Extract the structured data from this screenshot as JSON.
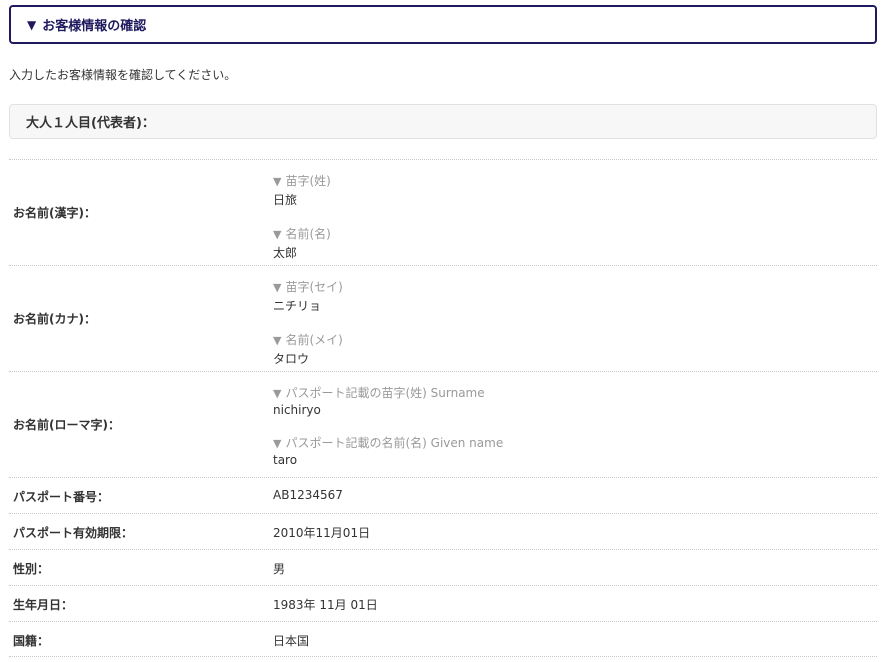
{
  "section": {
    "icon": "triangle-down-icon",
    "title": "お客様情報の確認"
  },
  "intro": "入力したお客様情報を確認してください。",
  "traveler_header": "大人１人目(代表者)：",
  "rows": {
    "name_kanji": {
      "label": "お名前(漢字)：",
      "family_label": "苗字(姓)",
      "family_value": "日旅",
      "given_label": "名前(名)",
      "given_value": "太郎"
    },
    "name_kana": {
      "label": "お名前(カナ)：",
      "family_label": "苗字(セイ)",
      "family_value": "ニチリョ",
      "given_label": "名前(メイ)",
      "given_value": "タロウ"
    },
    "name_roman": {
      "label": "お名前(ローマ字)：",
      "family_label": "パスポート記載の苗字(姓) Surname",
      "family_value": "nichiryo",
      "given_label": "パスポート記載の名前(名) Given name",
      "given_value": "taro"
    },
    "passport_number": {
      "label": "パスポート番号：",
      "value": "AB1234567"
    },
    "passport_expiry": {
      "label": "パスポート有効期限：",
      "value": "2010年11月01日"
    },
    "gender": {
      "label": "性別：",
      "value": "男"
    },
    "birthday": {
      "label": "生年月日：",
      "value": "1983年 11月 01日"
    },
    "nationality": {
      "label": "国籍：",
      "value": "日本国"
    }
  },
  "colors": {
    "accent": "#1f1a5e",
    "sublabel": "#9a9a9a",
    "text": "#333333"
  }
}
